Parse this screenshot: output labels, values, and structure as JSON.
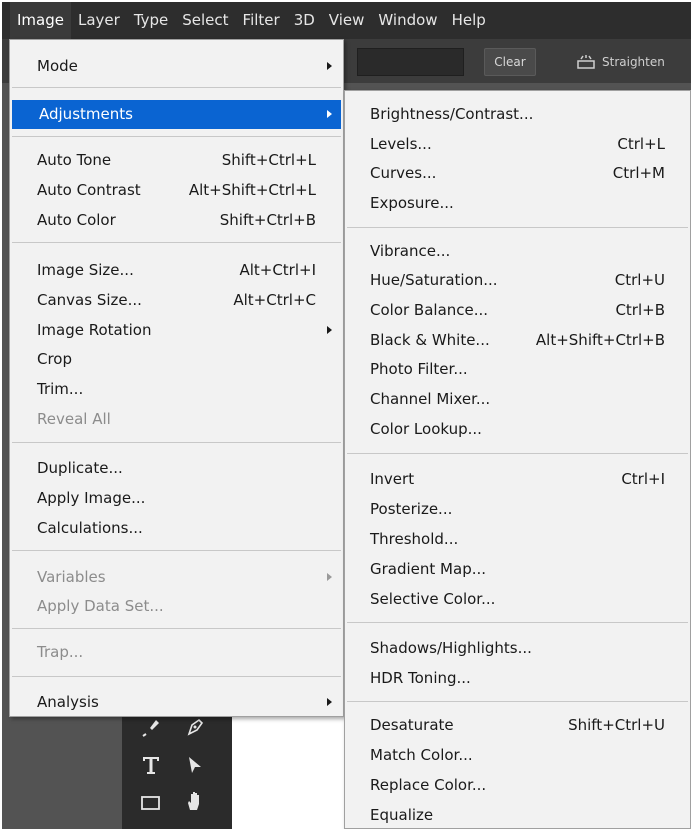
{
  "menubar": {
    "items": [
      "Image",
      "Layer",
      "Type",
      "Select",
      "Filter",
      "3D",
      "View",
      "Window",
      "Help"
    ]
  },
  "options_bar": {
    "clear_label": "Clear",
    "straighten_label": "Straighten"
  },
  "image_menu": {
    "items": [
      {
        "label": "Mode",
        "shortcut": "",
        "submenu": true
      },
      {
        "label": "Adjustments",
        "shortcut": "",
        "submenu": true,
        "highlighted": true
      },
      {
        "label": "Auto Tone",
        "shortcut": "Shift+Ctrl+L"
      },
      {
        "label": "Auto Contrast",
        "shortcut": "Alt+Shift+Ctrl+L"
      },
      {
        "label": "Auto Color",
        "shortcut": "Shift+Ctrl+B"
      },
      {
        "label": "Image Size...",
        "shortcut": "Alt+Ctrl+I"
      },
      {
        "label": "Canvas Size...",
        "shortcut": "Alt+Ctrl+C"
      },
      {
        "label": "Image Rotation",
        "shortcut": "",
        "submenu": true
      },
      {
        "label": "Crop",
        "shortcut": ""
      },
      {
        "label": "Trim...",
        "shortcut": ""
      },
      {
        "label": "Reveal All",
        "shortcut": "",
        "disabled": true
      },
      {
        "label": "Duplicate...",
        "shortcut": ""
      },
      {
        "label": "Apply Image...",
        "shortcut": ""
      },
      {
        "label": "Calculations...",
        "shortcut": ""
      },
      {
        "label": "Variables",
        "shortcut": "",
        "submenu": true,
        "disabled": true
      },
      {
        "label": "Apply Data Set...",
        "shortcut": "",
        "disabled": true
      },
      {
        "label": "Trap...",
        "shortcut": "",
        "disabled": true
      },
      {
        "label": "Analysis",
        "shortcut": "",
        "submenu": true
      }
    ]
  },
  "adjustments_menu": {
    "items": [
      {
        "label": "Brightness/Contrast...",
        "shortcut": ""
      },
      {
        "label": "Levels...",
        "shortcut": "Ctrl+L"
      },
      {
        "label": "Curves...",
        "shortcut": "Ctrl+M"
      },
      {
        "label": "Exposure...",
        "shortcut": ""
      },
      {
        "label": "Vibrance...",
        "shortcut": ""
      },
      {
        "label": "Hue/Saturation...",
        "shortcut": "Ctrl+U"
      },
      {
        "label": "Color Balance...",
        "shortcut": "Ctrl+B"
      },
      {
        "label": "Black & White...",
        "shortcut": "Alt+Shift+Ctrl+B"
      },
      {
        "label": "Photo Filter...",
        "shortcut": ""
      },
      {
        "label": "Channel Mixer...",
        "shortcut": ""
      },
      {
        "label": "Color Lookup...",
        "shortcut": ""
      },
      {
        "label": "Invert",
        "shortcut": "Ctrl+I"
      },
      {
        "label": "Posterize...",
        "shortcut": ""
      },
      {
        "label": "Threshold...",
        "shortcut": ""
      },
      {
        "label": "Gradient Map...",
        "shortcut": ""
      },
      {
        "label": "Selective Color...",
        "shortcut": ""
      },
      {
        "label": "Shadows/Highlights...",
        "shortcut": ""
      },
      {
        "label": "HDR Toning...",
        "shortcut": ""
      },
      {
        "label": "Desaturate",
        "shortcut": "Shift+Ctrl+U"
      },
      {
        "label": "Match Color...",
        "shortcut": ""
      },
      {
        "label": "Replace Color...",
        "shortcut": ""
      },
      {
        "label": "Equalize",
        "shortcut": ""
      }
    ]
  },
  "tools": {
    "icons": [
      "pen-tool-icon",
      "freeform-pen-icon",
      "type-tool-icon",
      "path-selection-icon",
      "rectangle-tool-icon",
      "hand-tool-icon"
    ]
  },
  "colors": {
    "highlight": "#0a64d2",
    "menu_background": "#f2f2f2",
    "menubar_background": "#2d2d2d"
  }
}
